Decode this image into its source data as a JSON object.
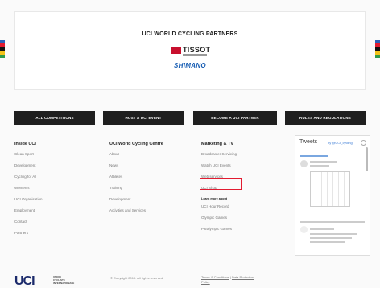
{
  "partners": {
    "title": "UCI WORLD CYCLING PARTNERS",
    "tissot_logo": "TISSOT",
    "shimano_logo": "SHIMANO"
  },
  "buttons": [
    "ALL COMPETITIONS",
    "HOST A UCI EVENT",
    "BECOME A UCI PARTNER",
    "RULES AND REGULATIONS"
  ],
  "footer": {
    "inside": {
      "heading": "Inside UCI",
      "links": [
        "Clean Sport",
        "Development",
        "Cycling for All",
        "Women's",
        "UCI Organisation",
        "Employment",
        "Contact",
        "Partners"
      ]
    },
    "wcc": {
      "heading": "UCI World Cycling Centre",
      "links": [
        "About",
        "News",
        "Athletes",
        "Training",
        "Development",
        "Activities and Services"
      ]
    },
    "marketing": {
      "heading": "Marketing & TV",
      "links": [
        "Broadcaster Servicing",
        "Watch UCI Events",
        "Web services",
        "UCI Shop"
      ],
      "learn_heading": "Learn more about",
      "learn_links": [
        "UCI Hour Record",
        "Olympic Games",
        "Paralympic Games"
      ]
    }
  },
  "tweets": {
    "title": "Tweets",
    "handle": "by @UCI_cycling"
  },
  "bottom": {
    "logo": "UCI",
    "logo_sub_1": "UNION",
    "logo_sub_2": "CYCLISTE",
    "logo_sub_3": "INTERNATIONALE",
    "copyright": "© Copyright 2019. All rights reserved.",
    "terms": "Terms & Conditions",
    "data_protection": "Data Protection",
    "policy": "Policy"
  },
  "colors": {
    "stripe": [
      "#2b62b8",
      "#e21b30",
      "#111111",
      "#f3c21a",
      "#2e9a4a"
    ],
    "highlight": "#e21b30"
  }
}
